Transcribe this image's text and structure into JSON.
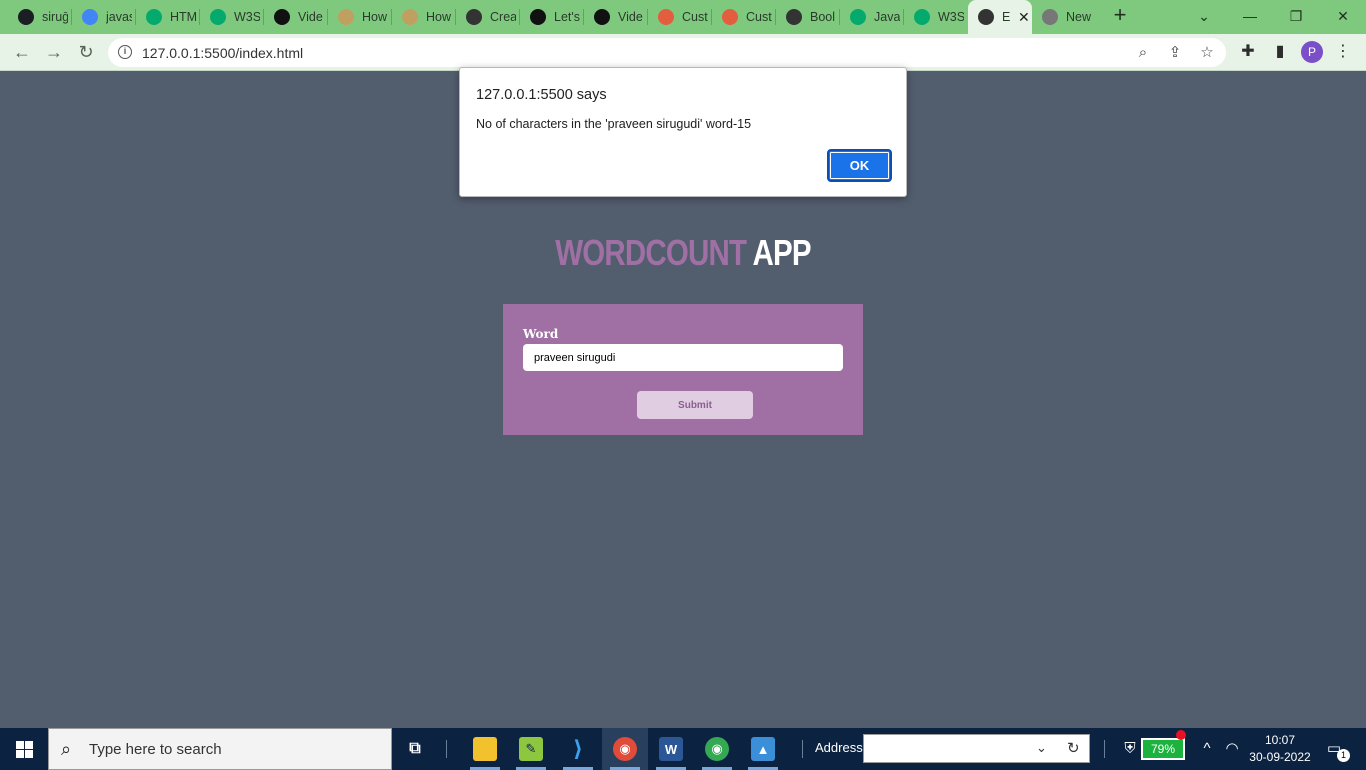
{
  "browser": {
    "tabs": [
      {
        "title": "siruḡ",
        "favicon": "github-icon",
        "color": "#1b1f23"
      },
      {
        "title": "javas",
        "favicon": "google-icon",
        "color": "#4285f4"
      },
      {
        "title": "HTM",
        "favicon": "w3schools-icon",
        "color": "#04aa6d"
      },
      {
        "title": "W3S",
        "favicon": "w3schools-icon",
        "color": "#04aa6d"
      },
      {
        "title": "Vide",
        "favicon": "m-icon",
        "color": "#111111"
      },
      {
        "title": "How",
        "favicon": "question-icon",
        "color": "#c0a060"
      },
      {
        "title": "How",
        "favicon": "question-icon",
        "color": "#c0a060"
      },
      {
        "title": "Crea",
        "favicon": "globe-icon",
        "color": "#333333"
      },
      {
        "title": "Let's",
        "favicon": "codepen-icon",
        "color": "#111111"
      },
      {
        "title": "Vide",
        "favicon": "eye-icon",
        "color": "#111111"
      },
      {
        "title": "Cust",
        "favicon": "code-icon",
        "color": "#e25e3e"
      },
      {
        "title": "Cust",
        "favicon": "code-icon",
        "color": "#e25e3e"
      },
      {
        "title": "Bool",
        "favicon": "globe-icon",
        "color": "#333333"
      },
      {
        "title": "Java",
        "favicon": "w3schools-icon",
        "color": "#04aa6d"
      },
      {
        "title": "W3S",
        "favicon": "w3schools-icon",
        "color": "#04aa6d"
      },
      {
        "title": "E",
        "favicon": "globe-icon",
        "color": "#333333",
        "active": true
      },
      {
        "title": "New",
        "favicon": "chrome-icon",
        "color": "#777777"
      }
    ],
    "url": "127.0.0.1:5500/index.html",
    "profile_initial": "P"
  },
  "page": {
    "title_part1": "WORDCOUNT",
    "title_part2": "APP",
    "word_label": "Word",
    "word_value": "praveen sirugudi",
    "submit_label": "Submit"
  },
  "dialog": {
    "title": "127.0.0.1:5500 says",
    "message": "No of characters in the 'praveen sirugudi' word-15",
    "ok_label": "OK"
  },
  "taskbar": {
    "search_placeholder": "Type here to search",
    "address_label": "Address",
    "battery": "79%",
    "time": "10:07",
    "date": "30-09-2022",
    "notification_count": "1"
  }
}
